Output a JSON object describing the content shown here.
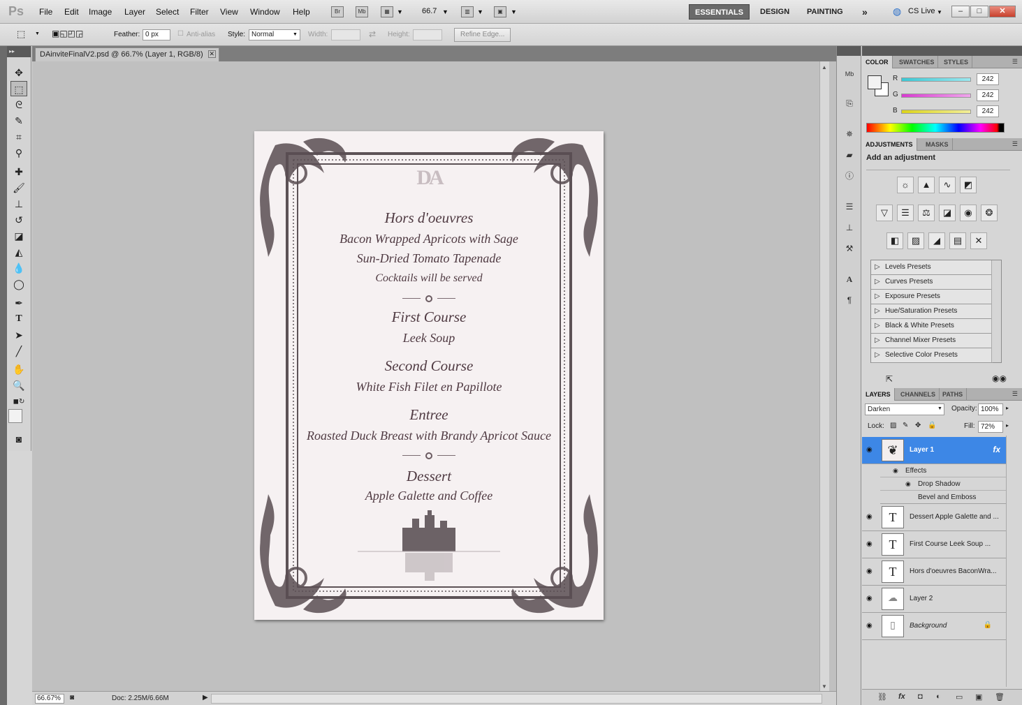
{
  "app": {
    "logo": "Ps",
    "menu": [
      "File",
      "Edit",
      "Image",
      "Layer",
      "Select",
      "Filter",
      "View",
      "Window",
      "Help"
    ],
    "bridge": "Br",
    "minibridge": "Mb",
    "zoom": "66.7",
    "workspaces": [
      "ESSENTIALS",
      "DESIGN",
      "PAINTING"
    ],
    "more": "»",
    "cs_live": "CS Live"
  },
  "options": {
    "feather_label": "Feather:",
    "feather_value": "0 px",
    "antialias_label": "Anti-alias",
    "style_label": "Style:",
    "style_value": "Normal",
    "width_label": "Width:",
    "height_label": "Height:",
    "refine_edge": "Refine Edge..."
  },
  "document": {
    "tab_title": "DAinviteFinalV2.psd @ 66.7% (Layer 1, RGB/8)",
    "zoom": "66.67%",
    "doc_size": "Doc: 2.25M/6.66M",
    "monogram": "DA",
    "sections": [
      {
        "heading": "Hors d'oeuvres",
        "items": [
          "Bacon Wrapped Apricots with Sage",
          "Sun-Dried Tomato Tapenade",
          "Cocktails will be served"
        ]
      },
      {
        "heading": "First Course",
        "items": [
          "Leek Soup"
        ]
      },
      {
        "heading": "Second Course",
        "items": [
          "White Fish Filet en Papillote"
        ]
      },
      {
        "heading": "Entree",
        "items": [
          "Roasted Duck Breast with Brandy Apricot Sauce"
        ]
      },
      {
        "heading": "Dessert",
        "items": [
          "Apple Galette and Coffee"
        ]
      }
    ]
  },
  "color_panel": {
    "tabs": [
      "COLOR",
      "SWATCHES",
      "STYLES"
    ],
    "channels": [
      {
        "label": "R",
        "value": "242",
        "color": "#35c9d9"
      },
      {
        "label": "G",
        "value": "242",
        "color": "#e040d8"
      },
      {
        "label": "B",
        "value": "242",
        "color": "#e0d820"
      }
    ]
  },
  "adjustments_panel": {
    "tabs": [
      "ADJUSTMENTS",
      "MASKS"
    ],
    "title": "Add an adjustment",
    "presets": [
      "Levels Presets",
      "Curves Presets",
      "Exposure Presets",
      "Hue/Saturation Presets",
      "Black & White Presets",
      "Channel Mixer Presets",
      "Selective Color Presets"
    ]
  },
  "layers_panel": {
    "tabs": [
      "LAYERS",
      "CHANNELS",
      "PATHS"
    ],
    "blend_mode": "Darken",
    "opacity_label": "Opacity:",
    "opacity": "100%",
    "lock_label": "Lock:",
    "fill_label": "Fill:",
    "fill": "72%",
    "layers": [
      {
        "name": "Layer 1",
        "thumb": "",
        "selected": true,
        "fx": "fx"
      },
      {
        "name": "Dessert Apple Galette and ...",
        "thumb": "T"
      },
      {
        "name": "First Course  Leek Soup  ...",
        "thumb": "T"
      },
      {
        "name": "Hors d'oeuvres BaconWra...",
        "thumb": "T"
      },
      {
        "name": "Layer 2",
        "thumb": ""
      },
      {
        "name": "Background",
        "thumb": "",
        "locked": true
      }
    ],
    "effects_label": "Effects",
    "effects": [
      "Drop Shadow",
      "Bevel and Emboss"
    ]
  }
}
